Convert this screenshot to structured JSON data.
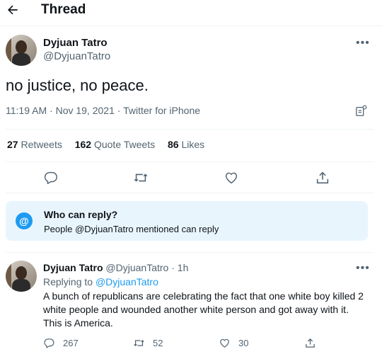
{
  "header": {
    "title": "Thread"
  },
  "tweet": {
    "author_name": "Dyjuan Tatro",
    "author_handle": "@DyjuanTatro",
    "text": "no justice, no peace.",
    "time": "11:19 AM",
    "date": "Nov 19, 2021",
    "source": "Twitter for iPhone",
    "separator": "·",
    "stats": {
      "retweets_count": "27",
      "retweets_label": "Retweets",
      "quotes_count": "162",
      "quotes_label": "Quote Tweets",
      "likes_count": "86",
      "likes_label": "Likes"
    }
  },
  "who_can_reply": {
    "title": "Who can reply?",
    "description": "People @DyjuanTatro mentioned can reply",
    "icon_text": "@"
  },
  "reply": {
    "author_name": "Dyjuan Tatro",
    "author_handle": "@DyjuanTatro",
    "separator": "·",
    "time": "1h",
    "replying_to_label": "Replying to",
    "replying_to_handle": "@DyjuanTatro",
    "text": "A bunch of republicans are celebrating the fact that one white boy killed 2 white people and  wounded another white person and got away with it. This is America.",
    "reply_count": "267",
    "retweet_count": "52",
    "like_count": "30"
  },
  "icons": [
    "back-arrow-icon",
    "more-icon",
    "analytics-icon",
    "reply-icon",
    "retweet-icon",
    "like-icon",
    "share-icon",
    "at-icon"
  ],
  "colors": {
    "accent": "#1d9bf0",
    "muted": "#536471",
    "text": "#0f1419",
    "reply_box_bg": "#e8f5fd"
  }
}
